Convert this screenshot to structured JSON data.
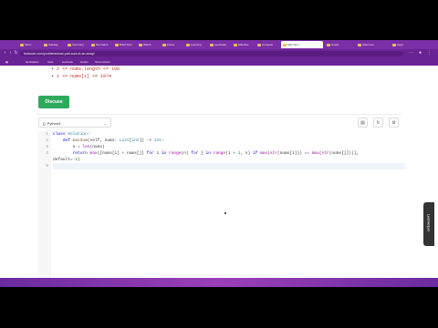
{
  "browser": {
    "tabs": [
      {
        "label": "Inbox"
      },
      {
        "label": "Subway"
      },
      {
        "label": "Summary"
      },
      {
        "label": "Net Gains"
      },
      {
        "label": "Build Solo"
      },
      {
        "label": "Watch"
      },
      {
        "label": "Focus"
      },
      {
        "label": "Learning"
      },
      {
        "label": "LeetCode"
      },
      {
        "label": "Effective"
      },
      {
        "label": "Compete"
      },
      {
        "label": "Max Sum"
      },
      {
        "label": "Graph"
      },
      {
        "label": "Afternoon"
      },
      {
        "label": "Apps"
      }
    ],
    "url": "leetcode.com/problems/max-pair-sum-in-an-array/",
    "bookmarks": [
      "workspace",
      "tools",
      "leetCode",
      "stocks",
      "Screenshots"
    ],
    "colors": {
      "chrome": "#7b2fa6",
      "accent": "#2eaa5c"
    }
  },
  "problem": {
    "constraints": [
      "2 <= nums.length <= 100",
      "1 <= nums[i] <= 10^4"
    ]
  },
  "discuss_button": "Discuss",
  "editor": {
    "language": "Python3",
    "toolbar_icons": [
      "file-icon",
      "reset-icon",
      "settings-icon"
    ],
    "line_numbers": [
      "1",
      "2",
      "3",
      "4",
      "",
      "5"
    ]
  },
  "sidebar_tab": "LeetHelper"
}
